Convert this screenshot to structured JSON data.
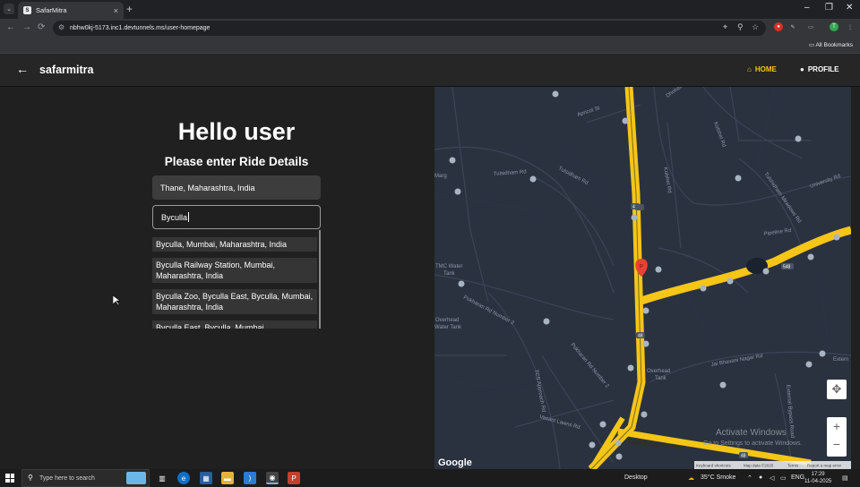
{
  "browser": {
    "tab_title": "SafarMitra",
    "url": "nbhw0kj-5173.inc1.devtunnels.ms/user-homepage",
    "all_bookmarks": "All Bookmarks",
    "profile_initial": "T"
  },
  "app": {
    "brand": "safarmitra",
    "nav": {
      "home": "HOME",
      "profile": "PROFILE"
    },
    "accent_color": "#f5c518"
  },
  "form": {
    "greeting": "Hello user",
    "subtitle": "Please enter Ride Details",
    "pickup_value": "Thane, Maharashtra, India",
    "destination_value": "Byculla"
  },
  "suggestions": [
    "Byculla, Mumbai, Maharashtra, India",
    "Byculla Railway Station, Mumbai, Maharashtra, India",
    "Byculla Zoo, Byculla East, Byculla, Mumbai, Maharashtra, India",
    "Byculla East, Byculla, Mumbai,"
  ],
  "map": {
    "labels": {
      "marg": "Marg",
      "tulsidham_rd": "Tulsidham Rd",
      "tulsidham_rd2": "Tulsidham Rd",
      "apricot": "Apricot St",
      "dhokali": "Dhokali - Balkum Rd",
      "kolshet": "Kolshet Rd",
      "kolshet2": "Kolshet Rd",
      "university": "University Rd",
      "pipeline": "Pipeline Rd",
      "tmc_water": "TMC Water",
      "tank": "Tank",
      "overhead_water": "Overhead",
      "water_tank": "Water Tank",
      "pokharan_rd2": "Pokharan Rd Number 2",
      "pokharan_rd2b": "Pokharan Rd Number 2",
      "overhead_tank": "Overhead",
      "tank2": "Tank",
      "tcs_approach": "TCS Approach Rd",
      "vasant_lawns": "Vasant Lawns Rd",
      "eastern_express": "Eastern Express Hwy",
      "jai_bhavani": "Jai Bhavani Nagar Rd",
      "extern": "Extern",
      "external_bypass": "External Bypass Road",
      "shelar": "Shelar Rd",
      "tulshidham_meadows": "Tulshidham Meadows Rd",
      "balkum": "Balkum Rd"
    },
    "route_shields": [
      "48",
      "48",
      "48",
      "48",
      "548"
    ],
    "marker": "P",
    "google": "Google",
    "watermark_1": "Activate Windows",
    "watermark_2": "Go to Settings to activate Windows.",
    "footer": [
      "Keyboard shortcuts",
      "Map data ©2025",
      "Terms",
      "Report a map error"
    ],
    "zoom_in": "+",
    "zoom_out": "−"
  },
  "taskbar": {
    "search_placeholder": "Type here to search",
    "desktop": "Desktop",
    "weather": "35°C Smoke",
    "lang": "ENG",
    "time": "17:29",
    "date": "11-04-2025"
  }
}
